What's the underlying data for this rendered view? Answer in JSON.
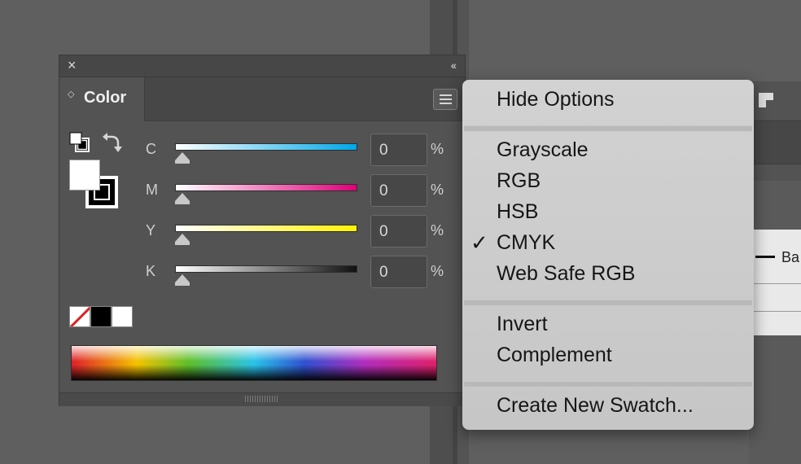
{
  "panel": {
    "tab_label": "Color",
    "close_glyph": "×",
    "collapse_glyph": "‹‹"
  },
  "sliders": [
    {
      "label": "C",
      "value": "0",
      "unit": "%",
      "gradient_end": "#00a8e8",
      "level": 0
    },
    {
      "label": "M",
      "value": "0",
      "unit": "%",
      "gradient_end": "#e0007a",
      "level": 0
    },
    {
      "label": "Y",
      "value": "0",
      "unit": "%",
      "gradient_end": "#fff200",
      "level": 0
    },
    {
      "label": "K",
      "value": "0",
      "unit": "%",
      "gradient_end": "#111111",
      "level": 0
    }
  ],
  "menu": {
    "items": [
      {
        "label": "Hide Options",
        "checked": false
      },
      {
        "label": "Grayscale",
        "checked": false
      },
      {
        "label": "RGB",
        "checked": false
      },
      {
        "label": "HSB",
        "checked": false
      },
      {
        "label": "CMYK",
        "checked": true
      },
      {
        "label": "Web Safe RGB",
        "checked": false
      },
      {
        "label": "Invert",
        "checked": false
      },
      {
        "label": "Complement",
        "checked": false
      },
      {
        "label": "Create New Swatch...",
        "checked": false
      }
    ],
    "check_glyph": "✓"
  },
  "background": {
    "doc_text": "Ba"
  }
}
